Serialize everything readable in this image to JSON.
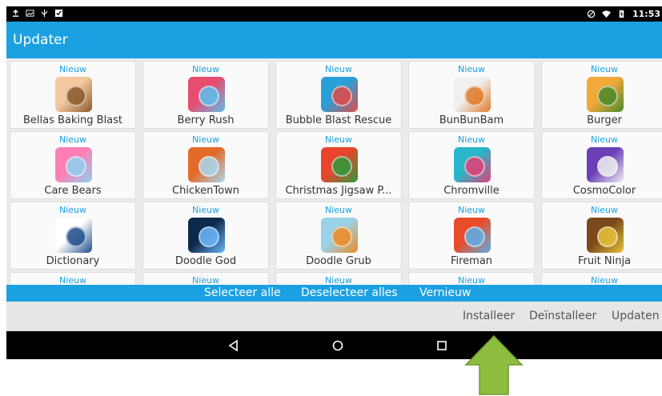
{
  "status": {
    "time": "11:53",
    "battery_icon": "battery-icon",
    "wifi_icon": "wifi-icon",
    "dnd_icon": "do-not-disturb-icon"
  },
  "app": {
    "title": "Updater"
  },
  "badge_label": "Nieuw",
  "apps": [
    {
      "name": "Bellas Baking Blast",
      "badge": "Nieuw",
      "colors": [
        "#f4c9a0",
        "#8a5a2b"
      ]
    },
    {
      "name": "Berry Rush",
      "badge": "Nieuw",
      "colors": [
        "#e84c6e",
        "#5cc0ee"
      ]
    },
    {
      "name": "Bubble Blast Rescue",
      "badge": "Nieuw",
      "colors": [
        "#2aa0d8",
        "#e24a4a"
      ]
    },
    {
      "name": "BunBunBam",
      "badge": "Nieuw",
      "colors": [
        "#f0f0f0",
        "#e07a2a"
      ]
    },
    {
      "name": "Burger",
      "badge": "Nieuw",
      "colors": [
        "#f2a93b",
        "#4a8a2a"
      ]
    },
    {
      "name": "Care Bears",
      "badge": "Nieuw",
      "colors": [
        "#ff7fb5",
        "#8fd0f0"
      ]
    },
    {
      "name": "ChickenTown",
      "badge": "Nieuw",
      "colors": [
        "#e46a2a",
        "#a8d8ef"
      ]
    },
    {
      "name": "Christmas Jigsaw P...",
      "badge": "Nieuw",
      "colors": [
        "#e8452c",
        "#2f9a3a"
      ]
    },
    {
      "name": "Chromville",
      "badge": "Nieuw",
      "colors": [
        "#29b6c8",
        "#e23f7a"
      ]
    },
    {
      "name": "CosmoColor",
      "badge": "Nieuw",
      "colors": [
        "#6a3fb8",
        "#f0f0f0"
      ]
    },
    {
      "name": "Dictionary",
      "badge": "Nieuw",
      "colors": [
        "#ffffff",
        "#1d4e8a"
      ]
    },
    {
      "name": "Doodle God",
      "badge": "Nieuw",
      "colors": [
        "#0e2a4a",
        "#6ab8ff"
      ]
    },
    {
      "name": "Doodle Grub",
      "badge": "Nieuw",
      "colors": [
        "#9ad2e8",
        "#f08a24"
      ]
    },
    {
      "name": "Fireman",
      "badge": "Nieuw",
      "colors": [
        "#e84c2a",
        "#5cb0e8"
      ]
    },
    {
      "name": "Fruit Ninja",
      "badge": "Nieuw",
      "colors": [
        "#7a4a1a",
        "#e8c23a"
      ]
    },
    {
      "name": "",
      "badge": "Nieuw",
      "colors": [
        "#fafafa",
        "#fafafa"
      ]
    },
    {
      "name": "",
      "badge": "Nieuw",
      "colors": [
        "#fafafa",
        "#fafafa"
      ]
    },
    {
      "name": "",
      "badge": "Nieuw",
      "colors": [
        "#fafafa",
        "#fafafa"
      ]
    },
    {
      "name": "",
      "badge": "Nieuw",
      "colors": [
        "#fafafa",
        "#fafafa"
      ]
    },
    {
      "name": "",
      "badge": "Nieuw",
      "colors": [
        "#fafafa",
        "#fafafa"
      ]
    }
  ],
  "selection_bar": {
    "select_all": "Selecteer alle",
    "deselect_all": "Deselecteer alles",
    "refresh": "Vernieuw"
  },
  "action_bar": {
    "install": "Installeer",
    "uninstall": "Deïnstalleer",
    "update": "Updaten"
  },
  "nav": {
    "back_icon": "back-icon",
    "home_icon": "home-icon",
    "recents_icon": "recents-icon"
  },
  "colors": {
    "accent": "#1ba1e2",
    "arrow": "#8cbd3f"
  },
  "annotation": {
    "icon": "up-arrow-icon"
  }
}
